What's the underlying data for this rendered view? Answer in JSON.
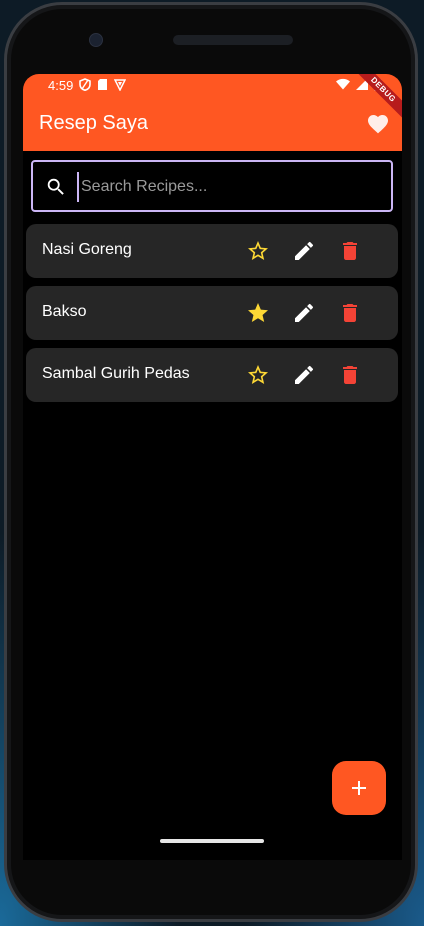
{
  "status": {
    "time": "4:59"
  },
  "appbar": {
    "title": "Resep Saya",
    "debug_label": "DEBUG"
  },
  "search": {
    "placeholder": "Search Recipes...",
    "value": ""
  },
  "recipes": [
    {
      "name": "Nasi Goreng",
      "favorite": false
    },
    {
      "name": "Bakso",
      "favorite": true
    },
    {
      "name": "Sambal Gurih Pedas",
      "favorite": false
    }
  ],
  "colors": {
    "primary": "#ff5722",
    "card": "#262626",
    "favorite_star": "#fdd835",
    "delete": "#f44336",
    "search_border": "#cbb6f5"
  },
  "icons": {
    "fab": "plus-icon",
    "appbar_action": "heart-icon",
    "search": "search-icon",
    "favorite": "star-icon",
    "edit": "pencil-icon",
    "delete": "trash-icon"
  }
}
